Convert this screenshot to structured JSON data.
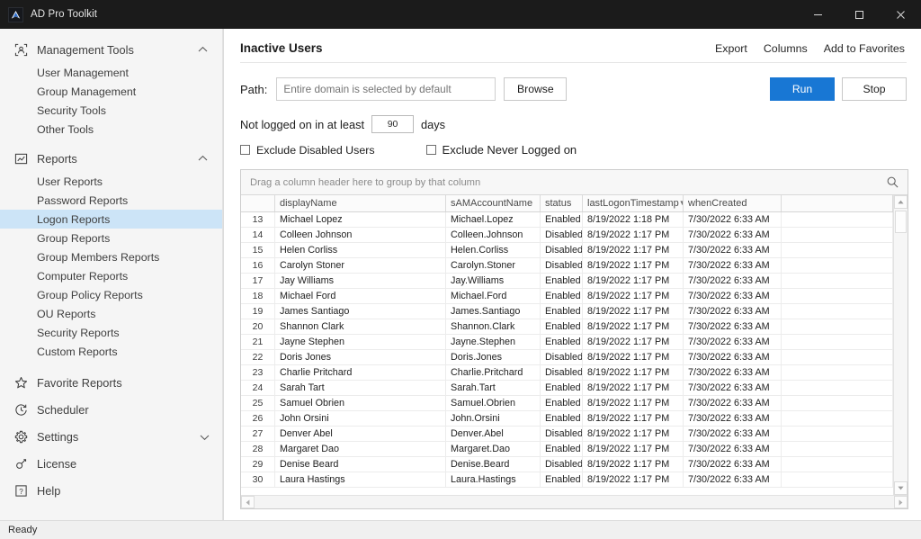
{
  "window": {
    "title": "AD Pro Toolkit",
    "app_icon": "ad-pro-logo-icon",
    "controls": {
      "minimize": "minimize-icon",
      "maximize": "maximize-icon",
      "close": "close-icon"
    }
  },
  "sidebar": {
    "groups": [
      {
        "label": "Management Tools",
        "icon": "users-bracket-icon",
        "chevron": "chevron-up-icon",
        "items": [
          {
            "label": "User Management"
          },
          {
            "label": "Group Management"
          },
          {
            "label": "Security Tools"
          },
          {
            "label": "Other Tools"
          }
        ]
      },
      {
        "label": "Reports",
        "icon": "chart-box-icon",
        "chevron": "chevron-up-icon",
        "items": [
          {
            "label": "User Reports"
          },
          {
            "label": "Password Reports"
          },
          {
            "label": "Logon Reports",
            "active": true
          },
          {
            "label": "Group Reports"
          },
          {
            "label": "Group Members Reports"
          },
          {
            "label": "Computer Reports"
          },
          {
            "label": "Group Policy Reports"
          },
          {
            "label": "OU Reports"
          },
          {
            "label": "Security Reports"
          },
          {
            "label": "Custom Reports"
          }
        ]
      }
    ],
    "items": [
      {
        "label": "Favorite Reports",
        "icon": "star-icon"
      },
      {
        "label": "Scheduler",
        "icon": "clock-refresh-icon"
      },
      {
        "label": "Settings",
        "icon": "gear-icon",
        "chevron": "chevron-down-icon"
      },
      {
        "label": "License",
        "icon": "key-icon"
      },
      {
        "label": "Help",
        "icon": "question-box-icon"
      }
    ]
  },
  "panel": {
    "title": "Inactive Users",
    "actions": [
      {
        "label": "Export"
      },
      {
        "label": "Columns"
      },
      {
        "label": "Add to Favorites"
      }
    ],
    "path": {
      "label": "Path:",
      "value": "",
      "placeholder": "Entire domain is selected by default",
      "browse_label": "Browse"
    },
    "run_label": "Run",
    "stop_label": "Stop",
    "run_color": "#1877d4",
    "days": {
      "prefix": "Not logged on in at least",
      "value": "90",
      "suffix": "days"
    },
    "checkboxes": [
      {
        "label": "Exclude Disabled Users",
        "checked": false
      },
      {
        "label": "Exclude Never Logged on",
        "checked": false
      }
    ]
  },
  "grid": {
    "group_hint": "Drag a column header here to group by that column",
    "search_icon": "search-icon",
    "columns": [
      {
        "key": "idx",
        "label": ""
      },
      {
        "key": "displayName",
        "label": "displayName"
      },
      {
        "key": "sAMAccountName",
        "label": "sAMAccountName"
      },
      {
        "key": "status",
        "label": "status"
      },
      {
        "key": "lastLogonTimestamp",
        "label": "lastLogonTimestamp",
        "sort": "descending"
      },
      {
        "key": "whenCreated",
        "label": "whenCreated"
      }
    ],
    "rows": [
      {
        "idx": "13",
        "displayName": "Michael Lopez",
        "sAMAccountName": "Michael.Lopez",
        "status": "Enabled",
        "lastLogonTimestamp": "8/19/2022 1:18 PM",
        "whenCreated": "7/30/2022 6:33 AM"
      },
      {
        "idx": "14",
        "displayName": "Colleen Johnson",
        "sAMAccountName": "Colleen.Johnson",
        "status": "Disabled",
        "lastLogonTimestamp": "8/19/2022 1:17 PM",
        "whenCreated": "7/30/2022 6:33 AM"
      },
      {
        "idx": "15",
        "displayName": "Helen Corliss",
        "sAMAccountName": "Helen.Corliss",
        "status": "Disabled",
        "lastLogonTimestamp": "8/19/2022 1:17 PM",
        "whenCreated": "7/30/2022 6:33 AM"
      },
      {
        "idx": "16",
        "displayName": "Carolyn Stoner",
        "sAMAccountName": "Carolyn.Stoner",
        "status": "Disabled",
        "lastLogonTimestamp": "8/19/2022 1:17 PM",
        "whenCreated": "7/30/2022 6:33 AM"
      },
      {
        "idx": "17",
        "displayName": "Jay Williams",
        "sAMAccountName": "Jay.Williams",
        "status": "Enabled",
        "lastLogonTimestamp": "8/19/2022 1:17 PM",
        "whenCreated": "7/30/2022 6:33 AM"
      },
      {
        "idx": "18",
        "displayName": "Michael Ford",
        "sAMAccountName": "Michael.Ford",
        "status": "Enabled",
        "lastLogonTimestamp": "8/19/2022 1:17 PM",
        "whenCreated": "7/30/2022 6:33 AM"
      },
      {
        "idx": "19",
        "displayName": "James Santiago",
        "sAMAccountName": "James.Santiago",
        "status": "Enabled",
        "lastLogonTimestamp": "8/19/2022 1:17 PM",
        "whenCreated": "7/30/2022 6:33 AM"
      },
      {
        "idx": "20",
        "displayName": "Shannon Clark",
        "sAMAccountName": "Shannon.Clark",
        "status": "Enabled",
        "lastLogonTimestamp": "8/19/2022 1:17 PM",
        "whenCreated": "7/30/2022 6:33 AM"
      },
      {
        "idx": "21",
        "displayName": "Jayne Stephen",
        "sAMAccountName": "Jayne.Stephen",
        "status": "Enabled",
        "lastLogonTimestamp": "8/19/2022 1:17 PM",
        "whenCreated": "7/30/2022 6:33 AM"
      },
      {
        "idx": "22",
        "displayName": "Doris Jones",
        "sAMAccountName": "Doris.Jones",
        "status": "Disabled",
        "lastLogonTimestamp": "8/19/2022 1:17 PM",
        "whenCreated": "7/30/2022 6:33 AM"
      },
      {
        "idx": "23",
        "displayName": "Charlie Pritchard",
        "sAMAccountName": "Charlie.Pritchard",
        "status": "Disabled",
        "lastLogonTimestamp": "8/19/2022 1:17 PM",
        "whenCreated": "7/30/2022 6:33 AM"
      },
      {
        "idx": "24",
        "displayName": "Sarah Tart",
        "sAMAccountName": "Sarah.Tart",
        "status": "Enabled",
        "lastLogonTimestamp": "8/19/2022 1:17 PM",
        "whenCreated": "7/30/2022 6:33 AM"
      },
      {
        "idx": "25",
        "displayName": "Samuel Obrien",
        "sAMAccountName": "Samuel.Obrien",
        "status": "Enabled",
        "lastLogonTimestamp": "8/19/2022 1:17 PM",
        "whenCreated": "7/30/2022 6:33 AM"
      },
      {
        "idx": "26",
        "displayName": "John Orsini",
        "sAMAccountName": "John.Orsini",
        "status": "Enabled",
        "lastLogonTimestamp": "8/19/2022 1:17 PM",
        "whenCreated": "7/30/2022 6:33 AM"
      },
      {
        "idx": "27",
        "displayName": "Denver Abel",
        "sAMAccountName": "Denver.Abel",
        "status": "Disabled",
        "lastLogonTimestamp": "8/19/2022 1:17 PM",
        "whenCreated": "7/30/2022 6:33 AM"
      },
      {
        "idx": "28",
        "displayName": "Margaret Dao",
        "sAMAccountName": "Margaret.Dao",
        "status": "Enabled",
        "lastLogonTimestamp": "8/19/2022 1:17 PM",
        "whenCreated": "7/30/2022 6:33 AM"
      },
      {
        "idx": "29",
        "displayName": "Denise Beard",
        "sAMAccountName": "Denise.Beard",
        "status": "Disabled",
        "lastLogonTimestamp": "8/19/2022 1:17 PM",
        "whenCreated": "7/30/2022 6:33 AM"
      },
      {
        "idx": "30",
        "displayName": "Laura Hastings",
        "sAMAccountName": "Laura.Hastings",
        "status": "Enabled",
        "lastLogonTimestamp": "8/19/2022 1:17 PM",
        "whenCreated": "7/30/2022 6:33 AM"
      }
    ]
  },
  "statusbar": {
    "text": "Ready"
  }
}
